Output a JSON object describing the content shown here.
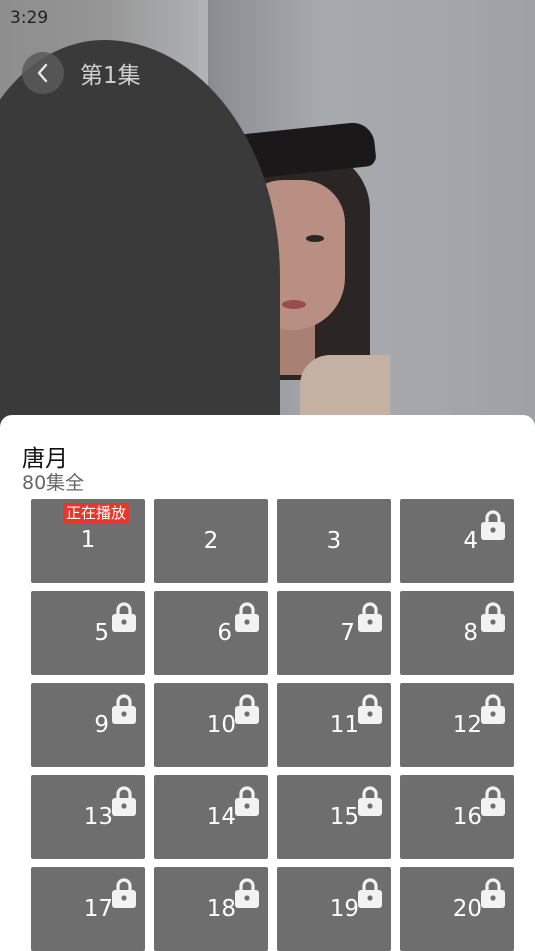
{
  "status": {
    "time": "3:29"
  },
  "player": {
    "title": "第1集"
  },
  "sheet": {
    "title": "唐月",
    "count": "80集全",
    "playing_badge": "正在播放"
  },
  "episodes": [
    {
      "n": "1",
      "locked": false,
      "playing": true
    },
    {
      "n": "2",
      "locked": false
    },
    {
      "n": "3",
      "locked": false
    },
    {
      "n": "4",
      "locked": true
    },
    {
      "n": "5",
      "locked": true
    },
    {
      "n": "6",
      "locked": true
    },
    {
      "n": "7",
      "locked": true
    },
    {
      "n": "8",
      "locked": true
    },
    {
      "n": "9",
      "locked": true
    },
    {
      "n": "10",
      "locked": true
    },
    {
      "n": "11",
      "locked": true
    },
    {
      "n": "12",
      "locked": true
    },
    {
      "n": "13",
      "locked": true
    },
    {
      "n": "14",
      "locked": true
    },
    {
      "n": "15",
      "locked": true
    },
    {
      "n": "16",
      "locked": true
    },
    {
      "n": "17",
      "locked": true
    },
    {
      "n": "18",
      "locked": true
    },
    {
      "n": "19",
      "locked": true
    },
    {
      "n": "20",
      "locked": true
    }
  ],
  "colors": {
    "tile": "#6e6e6e",
    "badge": "#e5372d"
  },
  "icons": {
    "back": "chevron-left-icon",
    "lock": "lock-icon"
  }
}
